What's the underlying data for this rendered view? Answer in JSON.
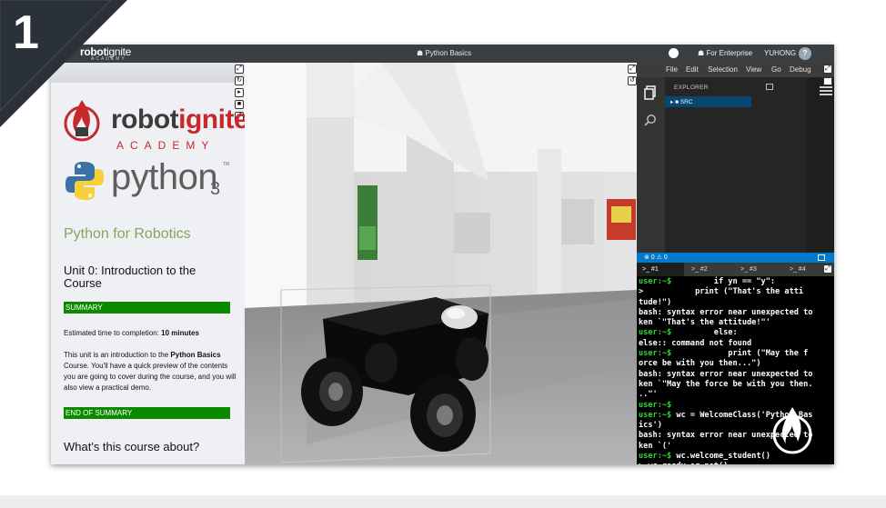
{
  "badge": {
    "number": "1"
  },
  "header": {
    "brand_robot": "robot",
    "brand_ignite": "ignite",
    "brand_sub": "ACADEMY",
    "course_title": "☗ Python Basics",
    "enterprise": "☗ For Enterprise",
    "username": "YUHONG",
    "help": "?"
  },
  "notebook": {
    "logo_robot": "robot",
    "logo_ignite": "ignite",
    "logo_academy": "ACADEMY",
    "python_word": "python",
    "python_sub": "3",
    "python_tm": "TM",
    "course_heading": "Python for Robotics",
    "unit_title": "Unit 0: Introduction to the Course",
    "summary_label": "SUMMARY",
    "estimated_prefix": "Estimated time to completion: ",
    "estimated_value": "10 minutes",
    "intro_prefix": "This unit is an introduction to the ",
    "intro_bold": "Python Basics",
    "intro_suffix": " Course. You'll have a quick preview of the contents you are going to cover during the course, and you will also view a practical demo.",
    "end_summary_label": "END OF SUMMARY",
    "about_heading": "What's this course about?"
  },
  "ide": {
    "menu": [
      "File",
      "Edit",
      "Selection",
      "View",
      "Go",
      "Debug"
    ],
    "explorer_title": "EXPLORER",
    "folder": "▸ ■ SRC",
    "status": "⊗ 0 ⚠ 0",
    "tabs": [
      ">_ #1",
      ">_ #2",
      ">_ #3",
      ">_ #4"
    ],
    "terminal": [
      {
        "p": "user:~$",
        "t": "         if yn == \"y\":"
      },
      {
        "p": "",
        "t": ">           print (\"That's the atti"
      },
      {
        "p": "",
        "t": "tude!\")"
      },
      {
        "p": "",
        "t": "bash: syntax error near unexpected to"
      },
      {
        "p": "",
        "t": "ken `\"That's the attitude!\"'"
      },
      {
        "p": "user:~$",
        "t": "         else:"
      },
      {
        "p": "",
        "t": "else:: command not found"
      },
      {
        "p": "user:~$",
        "t": "            print (\"May the f"
      },
      {
        "p": "",
        "t": "orce be with you then...\")"
      },
      {
        "p": "",
        "t": "bash: syntax error near unexpected to"
      },
      {
        "p": "",
        "t": "ken `\"May the force be with you then."
      },
      {
        "p": "",
        "t": "..\"'"
      },
      {
        "p": "user:~$",
        "t": ""
      },
      {
        "p": "user:~$",
        "t": " wc = WelcomeClass('Python Bas"
      },
      {
        "p": "",
        "t": "ics')"
      },
      {
        "p": "",
        "t": "bash: syntax error near unexpected to"
      },
      {
        "p": "",
        "t": "ken `('"
      },
      {
        "p": "user:~$",
        "t": " wc.welcome_student()"
      },
      {
        "p": "",
        "t": "> wc.ready_or_not()"
      }
    ]
  },
  "colors": {
    "accent_green": "#0b8a00",
    "brand_red": "#c6282b",
    "status_blue": "#007acc",
    "prompt_green": "#2fd32f"
  }
}
